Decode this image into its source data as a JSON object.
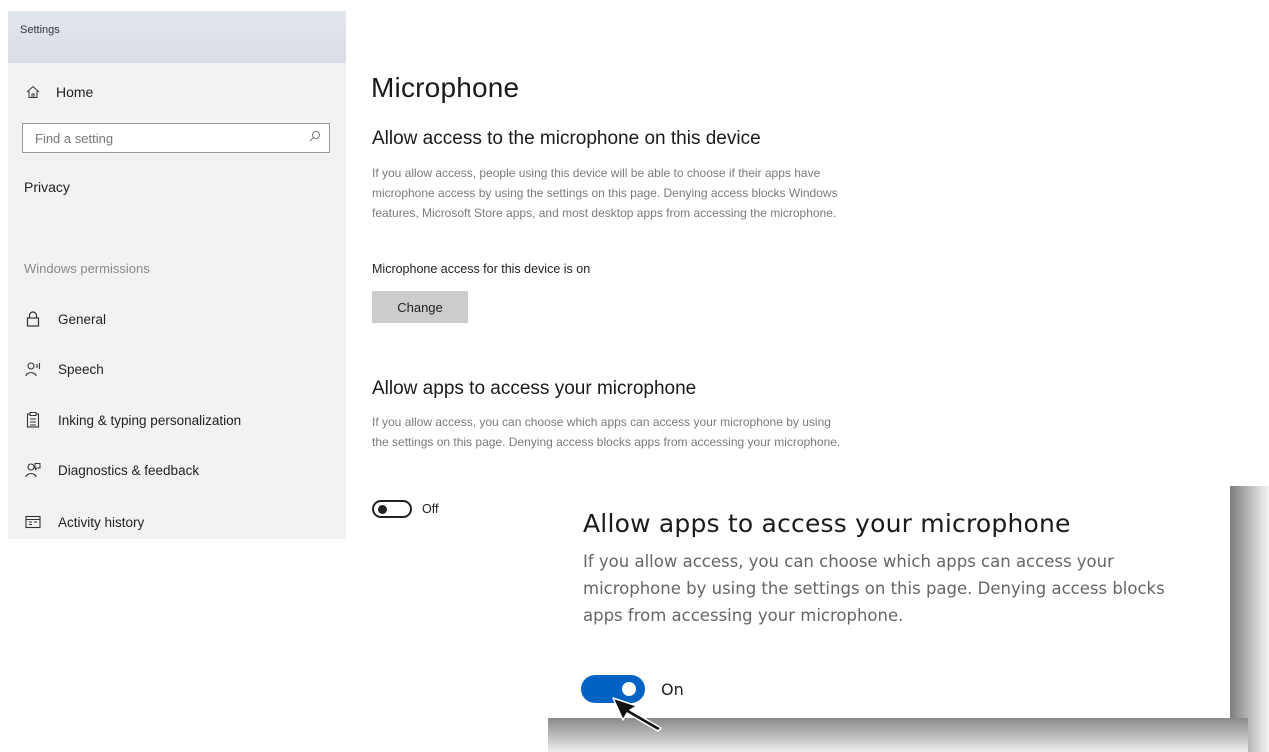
{
  "window": {
    "title": "Settings"
  },
  "sidebar": {
    "home_label": "Home",
    "search_placeholder": "Find a setting",
    "category": "Privacy",
    "section_label": "Windows permissions",
    "items": [
      {
        "label": "General",
        "icon": "lock-icon"
      },
      {
        "label": "Speech",
        "icon": "speech-icon"
      },
      {
        "label": "Inking & typing personalization",
        "icon": "inking-icon"
      },
      {
        "label": "Diagnostics & feedback",
        "icon": "diagnostics-icon"
      },
      {
        "label": "Activity history",
        "icon": "activity-history-icon"
      }
    ]
  },
  "main": {
    "title": "Microphone",
    "device_section": {
      "heading": "Allow access to the microphone on this device",
      "description": "If you allow access, people using this device will be able to choose if their apps have microphone access by using the settings on this page. Denying access blocks Windows features, Microsoft Store apps, and most desktop apps from accessing the microphone.",
      "status": "Microphone access for this device is on",
      "change_label": "Change"
    },
    "apps_section": {
      "heading": "Allow apps to access your microphone",
      "description": "If you allow access, you can choose which apps can access your microphone by using the settings on this page. Denying access blocks apps from accessing your microphone.",
      "toggle_label": "Off"
    }
  },
  "callout": {
    "heading": "Allow apps to access your microphone",
    "description": "If you allow access, you can choose which apps can access your microphone by using the settings on this page. Denying access blocks apps from accessing your microphone.",
    "toggle_label": "On"
  },
  "colors": {
    "accent": "#0063c4",
    "sidebar_bg": "#f2f2f2",
    "button_bg": "#cccccc"
  }
}
